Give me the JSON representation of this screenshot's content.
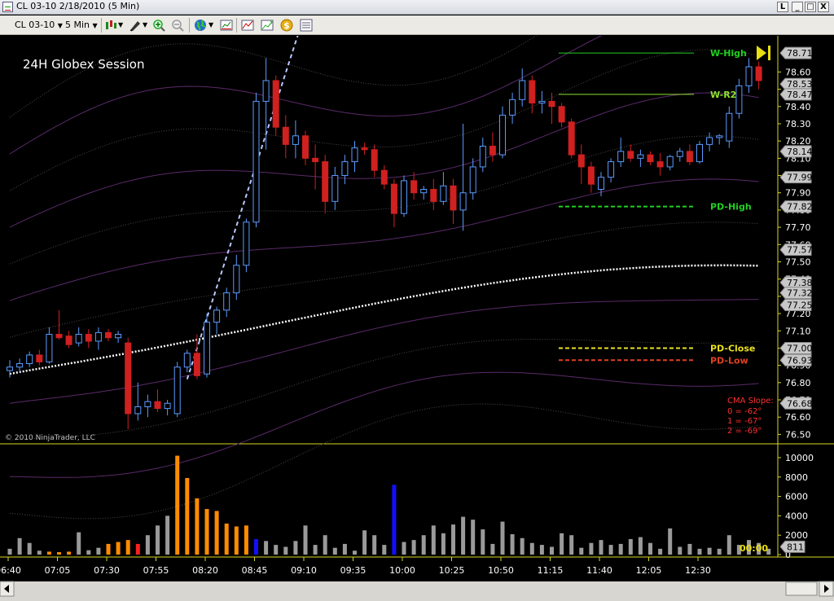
{
  "window": {
    "title": "CL 03-10  2/18/2010 (5 Min)",
    "buttons": [
      "L",
      "_",
      "□",
      "X"
    ]
  },
  "toolbar": {
    "instrument": "CL 03-10",
    "period": "5 Min"
  },
  "chart_data": {
    "type": "candlestick",
    "session_label": "24H Globex Session",
    "copyright": "© 2010 NinjaTrader, LLC",
    "price_ticks": [
      "78.60",
      "78.50",
      "78.40",
      "78.30",
      "78.20",
      "78.10",
      "78.00",
      "77.90",
      "77.80",
      "77.70",
      "77.60",
      "77.50",
      "77.40",
      "77.30",
      "77.20",
      "77.10",
      "77.00",
      "76.90",
      "76.80",
      "76.70",
      "76.60",
      "76.50"
    ],
    "price_range": [
      76.45,
      78.8
    ],
    "price_badges": [
      "78.71",
      "78.53",
      "78.47",
      "78.14",
      "77.99",
      "77.82",
      "77.57",
      "77.38",
      "77.32",
      "77.25",
      "77.00",
      "76.93",
      "76.68"
    ],
    "levels": [
      {
        "label": "W-High",
        "price": 78.71,
        "color": "#20d020"
      },
      {
        "label": "W-R2",
        "price": 78.47,
        "color": "#90e030"
      },
      {
        "label": "PD-High",
        "price": 77.82,
        "color": "#20d020"
      },
      {
        "label": "PD-Close",
        "price": 77.0,
        "color": "#e8e020"
      },
      {
        "label": "PD-Low",
        "price": 76.93,
        "color": "#e04020"
      }
    ],
    "cma_slope": {
      "title": "CMA Slope:",
      "lines": [
        "0 = -62°",
        "1 = -67°",
        "2 = -69°"
      ]
    },
    "time_labels": [
      "06:40",
      "07:05",
      "07:30",
      "07:55",
      "08:20",
      "08:45",
      "09:10",
      "09:35",
      "10:00",
      "10:25",
      "10:50",
      "11:15",
      "11:40",
      "12:05",
      "12:30"
    ],
    "volume_ticks": [
      "10000",
      "8000",
      "6000",
      "4000",
      "2000",
      "0"
    ],
    "volume_range": [
      0,
      10500
    ],
    "volume_current": "811",
    "countdown": "00:00",
    "candles": [
      [
        76.87,
        76.93,
        76.83,
        76.89
      ],
      [
        76.89,
        76.94,
        76.86,
        76.91
      ],
      [
        76.91,
        76.98,
        76.89,
        76.96
      ],
      [
        76.96,
        76.99,
        76.9,
        76.92
      ],
      [
        76.92,
        77.12,
        76.91,
        77.08
      ],
      [
        77.08,
        77.22,
        77.05,
        77.06
      ],
      [
        77.07,
        77.1,
        77.0,
        77.02
      ],
      [
        77.03,
        77.12,
        77.01,
        77.08
      ],
      [
        77.08,
        77.11,
        77.0,
        77.04
      ],
      [
        77.04,
        77.12,
        76.99,
        77.09
      ],
      [
        77.09,
        77.11,
        77.04,
        77.06
      ],
      [
        77.06,
        77.1,
        77.03,
        77.08
      ],
      [
        77.03,
        77.06,
        76.53,
        76.62
      ],
      [
        76.62,
        76.8,
        76.58,
        76.66
      ],
      [
        76.66,
        76.73,
        76.6,
        76.69
      ],
      [
        76.69,
        76.76,
        76.63,
        76.65
      ],
      [
        76.65,
        76.7,
        76.61,
        76.68
      ],
      [
        76.62,
        76.92,
        76.6,
        76.89
      ],
      [
        76.89,
        76.99,
        76.86,
        76.97
      ],
      [
        76.97,
        77.08,
        76.82,
        76.84
      ],
      [
        76.85,
        77.2,
        76.83,
        77.15
      ],
      [
        77.15,
        77.24,
        77.08,
        77.22
      ],
      [
        77.22,
        77.35,
        77.18,
        77.32
      ],
      [
        77.32,
        77.54,
        77.28,
        77.48
      ],
      [
        77.48,
        77.75,
        77.44,
        77.73
      ],
      [
        77.73,
        78.48,
        77.7,
        78.43
      ],
      [
        78.43,
        78.68,
        78.15,
        78.55
      ],
      [
        78.55,
        78.58,
        78.23,
        78.28
      ],
      [
        78.28,
        78.35,
        78.1,
        78.18
      ],
      [
        78.18,
        78.32,
        78.1,
        78.23
      ],
      [
        78.23,
        78.26,
        78.06,
        78.1
      ],
      [
        78.1,
        78.18,
        77.92,
        78.08
      ],
      [
        78.08,
        78.12,
        77.78,
        77.85
      ],
      [
        77.85,
        78.05,
        77.8,
        78.0
      ],
      [
        78.0,
        78.12,
        77.95,
        78.08
      ],
      [
        78.08,
        78.2,
        78.02,
        78.16
      ],
      [
        78.16,
        78.19,
        78.12,
        78.15
      ],
      [
        78.15,
        78.18,
        77.99,
        78.03
      ],
      [
        78.03,
        78.06,
        77.92,
        77.95
      ],
      [
        77.95,
        77.98,
        77.7,
        77.78
      ],
      [
        77.78,
        78.0,
        77.76,
        77.97
      ],
      [
        77.97,
        78.02,
        77.86,
        77.9
      ],
      [
        77.9,
        77.94,
        77.86,
        77.92
      ],
      [
        77.92,
        77.98,
        77.8,
        77.85
      ],
      [
        77.85,
        78.02,
        77.83,
        77.94
      ],
      [
        77.94,
        77.98,
        77.72,
        77.8
      ],
      [
        77.8,
        78.3,
        77.68,
        77.9
      ],
      [
        77.9,
        78.1,
        77.86,
        78.05
      ],
      [
        78.05,
        78.22,
        78.02,
        78.17
      ],
      [
        78.17,
        78.25,
        78.08,
        78.12
      ],
      [
        78.12,
        78.4,
        78.1,
        78.35
      ],
      [
        78.35,
        78.48,
        78.3,
        78.44
      ],
      [
        78.44,
        78.62,
        78.4,
        78.55
      ],
      [
        78.55,
        78.58,
        78.36,
        78.42
      ],
      [
        78.42,
        78.49,
        78.36,
        78.43
      ],
      [
        78.43,
        78.48,
        78.3,
        78.4
      ],
      [
        78.4,
        78.42,
        78.28,
        78.31
      ],
      [
        78.31,
        78.33,
        78.1,
        78.12
      ],
      [
        78.12,
        78.18,
        77.95,
        78.05
      ],
      [
        78.05,
        78.08,
        77.9,
        77.95
      ],
      [
        77.92,
        78.02,
        77.88,
        77.99
      ],
      [
        77.99,
        78.1,
        77.96,
        78.08
      ],
      [
        78.08,
        78.22,
        78.05,
        78.14
      ],
      [
        78.14,
        78.18,
        78.08,
        78.1
      ],
      [
        78.1,
        78.15,
        78.05,
        78.12
      ],
      [
        78.12,
        78.14,
        78.06,
        78.08
      ],
      [
        78.08,
        78.13,
        78.0,
        78.05
      ],
      [
        78.05,
        78.12,
        78.03,
        78.11
      ],
      [
        78.11,
        78.16,
        78.08,
        78.14
      ],
      [
        78.14,
        78.18,
        78.06,
        78.08
      ],
      [
        78.08,
        78.2,
        78.07,
        78.18
      ],
      [
        78.18,
        78.25,
        78.14,
        78.22
      ],
      [
        78.22,
        78.24,
        78.18,
        78.23
      ],
      [
        78.2,
        78.4,
        78.16,
        78.36
      ],
      [
        78.36,
        78.56,
        78.33,
        78.52
      ],
      [
        78.52,
        78.68,
        78.48,
        78.63
      ],
      [
        78.63,
        78.66,
        78.5,
        78.55
      ]
    ],
    "volume": [
      600,
      1700,
      1200,
      400,
      300,
      250,
      300,
      2300,
      450,
      700,
      1100,
      1300,
      1500,
      1100,
      2000,
      3000,
      4000,
      10200,
      7900,
      5800,
      4700,
      4500,
      3200,
      2900,
      3000,
      1600,
      1400,
      1000,
      800,
      1400,
      3000,
      1000,
      2000,
      700,
      1100,
      400,
      2500,
      2000,
      1000,
      7200,
      1300,
      1500,
      2000,
      3000,
      2200,
      3100,
      3900,
      3600,
      2600,
      1100,
      3400,
      2100,
      1700,
      1200,
      1000,
      800,
      2200,
      2000,
      700,
      1200,
      1500,
      1000,
      1100,
      1600,
      1800,
      1200,
      600,
      2700,
      800,
      1100,
      600,
      700,
      600,
      2000,
      1000,
      1500,
      1200,
      600
    ],
    "volume_colors": {
      "up": "#9a9a9a",
      "orange": "#ff8c00",
      "red": "#ff2020",
      "blue": "#1010ff"
    },
    "colors": {
      "up_candle": "#5b9bff",
      "down_candle": "#d02020",
      "vwap": "#ffffff",
      "band": "#7a3a8a"
    }
  }
}
